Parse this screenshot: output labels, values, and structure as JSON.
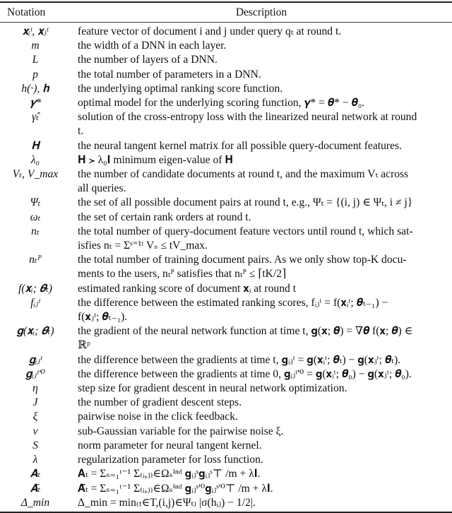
{
  "table": {
    "headers": {
      "notation": "Notation",
      "description": "Description"
    },
    "rows": [
      {
        "symbol": "𝐱ᵢᵗ, 𝐱ⱼᵗ",
        "description": [
          "feature vector of document i and j under query qₜ at round t."
        ]
      },
      {
        "symbol": "m",
        "description": [
          "the width of a DNN in each layer."
        ]
      },
      {
        "symbol": "L",
        "description": [
          "the number of layers of a DNN."
        ]
      },
      {
        "symbol": "p",
        "description": [
          "the total number of parameters in a DNN."
        ]
      },
      {
        "symbol": "h(·), 𝐡",
        "description": [
          "the underlying optimal ranking score function."
        ]
      },
      {
        "symbol": "𝜸*",
        "description": [
          "optimal model for the underlying scoring function, 𝜸* = 𝜽* − 𝜽₀."
        ]
      },
      {
        "symbol": "γ̂ₜ",
        "description": [
          "solution of the cross-entropy loss with the linearized neural network at round",
          "t."
        ]
      },
      {
        "symbol": "𝐇",
        "description": [
          "the neural tangent kernel matrix for all possible query-document features."
        ]
      },
      {
        "symbol": "λ₀",
        "description": [
          "𝐇 ≻ λ₀𝐈 minimum eigen-value of 𝐇"
        ]
      },
      {
        "symbol": "Vₜ, V_max",
        "description": [
          "the number of candidate documents at round t, and the maximum Vₜ across",
          "all queries."
        ]
      },
      {
        "symbol": "Ψₜ",
        "description": [
          "the set of all possible document pairs at round t, e.g., Ψₜ = {(i, j) ∈ Ψₜ, i ≠ j}"
        ]
      },
      {
        "symbol": "ωₜ",
        "description": [
          "the set of certain rank orders at round t."
        ]
      },
      {
        "symbol": "nₜ",
        "description": [
          "the total number of query-document feature vectors until round t, which sat-",
          "isfies nₜ = Σˢ⁼¹ᵗ Vₛ ≤ tV_max."
        ]
      },
      {
        "symbol": "nₜᴾ",
        "description": [
          "the total number of training document pairs. As we only show top-K docu-",
          "ments to the users, nₜᴾ satisfies that nₜᴾ ≤ ⌈tK/2⌉"
        ]
      },
      {
        "symbol": "f(𝐱ᵢ; 𝜽ₜ)",
        "description": [
          "estimated ranking score of document 𝐱ᵢ at round t"
        ]
      },
      {
        "symbol": "fᵢⱼᵗ",
        "description": [
          "the difference between the estimated ranking scores, fᵢⱼᵗ = f(𝐱ᵢᵗ; 𝜽ₜ₋₁) −",
          "f(𝐱ⱼᵗ; 𝜽ₜ₋₁)."
        ]
      },
      {
        "symbol": "𝐠(𝐱ᵢ; 𝜽ₜ)",
        "description": [
          "the gradient of the neural network function at time t, 𝐠(𝐱; 𝜽) = ∇𝜽 f(𝐱; 𝜽) ∈",
          "ℝᵖ"
        ]
      },
      {
        "symbol": "𝐠ᵢⱼᵗ",
        "description": [
          "the difference between the gradients at time t, 𝐠ᵢⱼᵗ = 𝐠(𝐱ᵢᵗ; 𝜽ₜ) − 𝐠(𝐱ⱼᵗ; 𝜽ₜ)."
        ]
      },
      {
        "symbol": "𝐠ᵢⱼᵗ'⁰",
        "description": [
          "the difference between the gradients at time 0, 𝐠ᵢⱼᵗ'⁰ = 𝐠(𝐱ᵢᵗ; 𝜽₀) − 𝐠(𝐱ⱼᵗ; 𝜽₀)."
        ]
      },
      {
        "symbol": "η",
        "description": [
          "step size for gradient descent in neural network optimization."
        ]
      },
      {
        "symbol": "J",
        "description": [
          "the number of gradient descent steps."
        ]
      },
      {
        "symbol": "ξ",
        "description": [
          "pairwise noise in the click feedback."
        ]
      },
      {
        "symbol": "ν",
        "description": [
          "sub-Gaussian variable for the pairwise noise ξ."
        ]
      },
      {
        "symbol": "S",
        "description": [
          "norm parameter for neural tangent kernel."
        ]
      },
      {
        "symbol": "λ",
        "description": [
          "regularization parameter for loss function."
        ]
      },
      {
        "symbol": "𝐀ₜ",
        "description": [
          "𝐀ₜ = Σₛ₌₁ᵗ⁻¹ Σ₍ᵢ,ⱼ₎∈Ωₛⁱⁿᵈ 𝐠ᵢⱼˢ𝐠ᵢⱼˢ⊤ /m + λ𝐈."
        ]
      },
      {
        "symbol": "𝐀̄ₜ",
        "description": [
          "𝐀̄ₜ = Σₛ₌₁ᵗ⁻¹ Σ₍ᵢ,ⱼ₎∈Ωₛⁱⁿᵈ 𝐠ᵢⱼˢ'⁰𝐠ᵢⱼˢ'⁰⊤ /m + λ𝐈."
        ]
      },
      {
        "symbol": "Δ_min",
        "description": [
          "Δ_min = min₍ₜ∈T,(i,j)∈Ψₜ₎ |σ(hᵢⱼ) − 1/2|."
        ]
      }
    ]
  }
}
